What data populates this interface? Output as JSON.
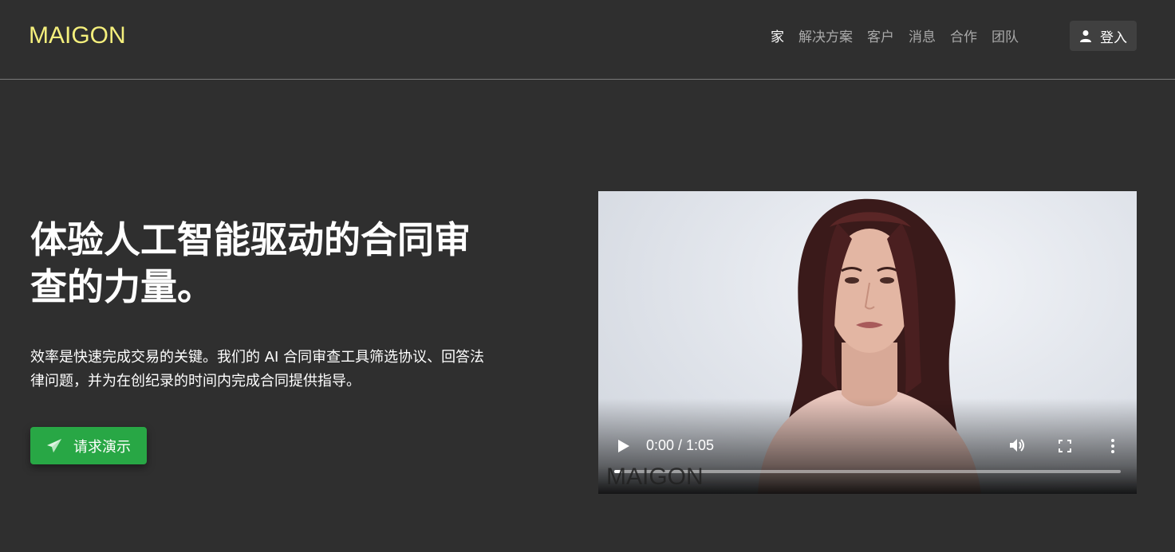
{
  "header": {
    "logo": "MAIGON",
    "nav": [
      {
        "label": "家",
        "active": true
      },
      {
        "label": "解决方案",
        "active": false
      },
      {
        "label": "客户",
        "active": false
      },
      {
        "label": "消息",
        "active": false
      },
      {
        "label": "合作",
        "active": false
      },
      {
        "label": "团队",
        "active": false
      }
    ],
    "login_label": "登入"
  },
  "hero": {
    "title_line1": "体验人工智能驱动的合同审",
    "title_line2": "查的力量。",
    "description_line1": "效率是快速完成交易的关键。我们的 AI 合同审查工具筛选协议、回答法",
    "description_line2": "律问题，并为在创纪录的时间内完成合同提供指导。",
    "cta_label": "请求演示"
  },
  "video": {
    "time_display": "0:00 / 1:05",
    "progress": 0.0,
    "watermark": "MAIGON"
  },
  "colors": {
    "background": "#2f2f2f",
    "logo": "#f4ef7c",
    "cta": "#28a745"
  }
}
